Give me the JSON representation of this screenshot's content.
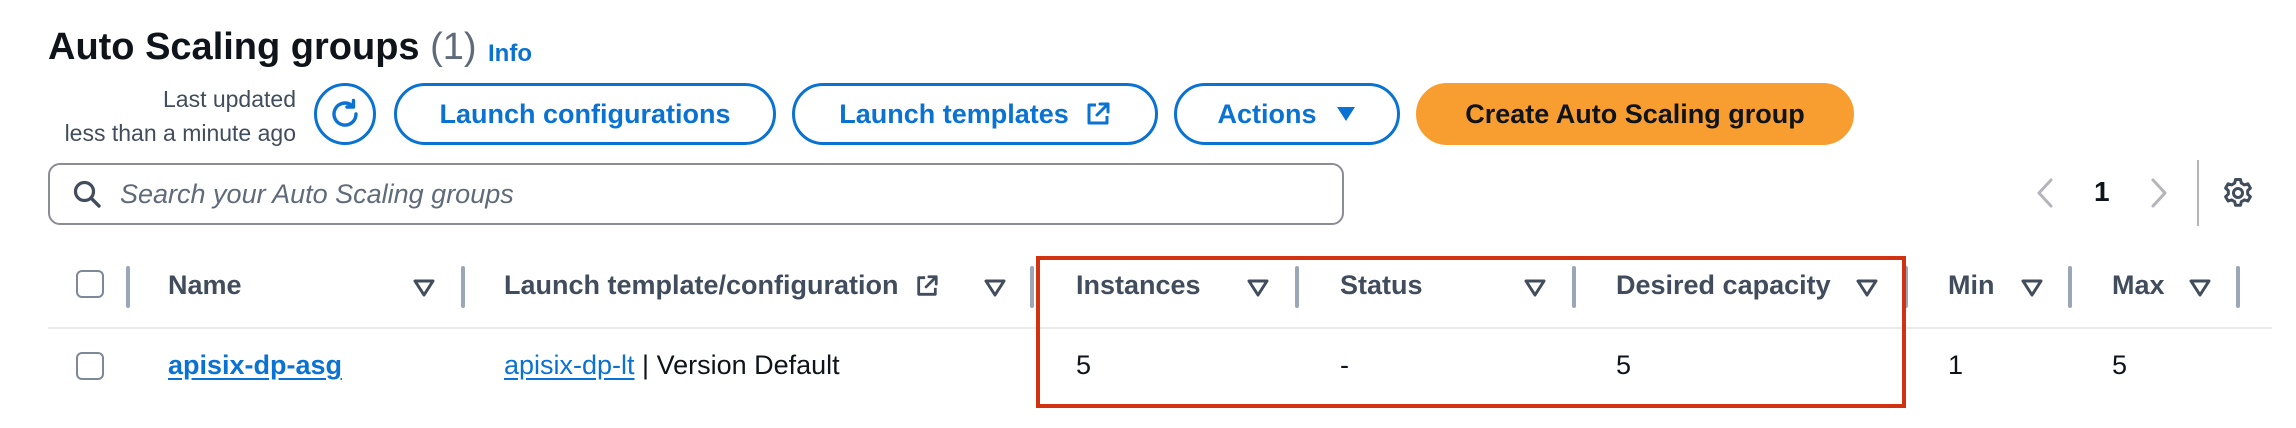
{
  "page": {
    "title": "Auto Scaling groups",
    "count": "(1)",
    "info_link": "Info"
  },
  "toolbar": {
    "last_updated_line1": "Last updated",
    "last_updated_line2": "less than a minute ago",
    "refresh_icon": "refresh-icon",
    "launch_configurations_label": "Launch configurations",
    "launch_templates_label": "Launch templates",
    "launch_templates_icon": "external-link-icon",
    "actions_label": "Actions",
    "actions_icon": "caret-down-icon",
    "create_label": "Create Auto Scaling group"
  },
  "search": {
    "placeholder": "Search your Auto Scaling groups",
    "value": ""
  },
  "pagination": {
    "current_page": "1",
    "prev_icon": "chevron-left-icon",
    "next_icon": "chevron-right-icon",
    "settings_icon": "gear-icon"
  },
  "table": {
    "columns": {
      "name": "Name",
      "launch_template": "Launch template/configuration",
      "instances": "Instances",
      "status": "Status",
      "desired_capacity": "Desired capacity",
      "min": "Min",
      "max": "Max"
    },
    "rows": [
      {
        "name": "apisix-dp-asg",
        "launch_template_link": "apisix-dp-lt",
        "launch_template_suffix": " | Version Default",
        "instances": "5",
        "status": "-",
        "desired_capacity": "5",
        "min": "1",
        "max": "5"
      }
    ]
  },
  "colors": {
    "primary_blue": "#0972d3",
    "create_button_orange": "#f89e30",
    "highlight_box_red": "#d13212"
  }
}
